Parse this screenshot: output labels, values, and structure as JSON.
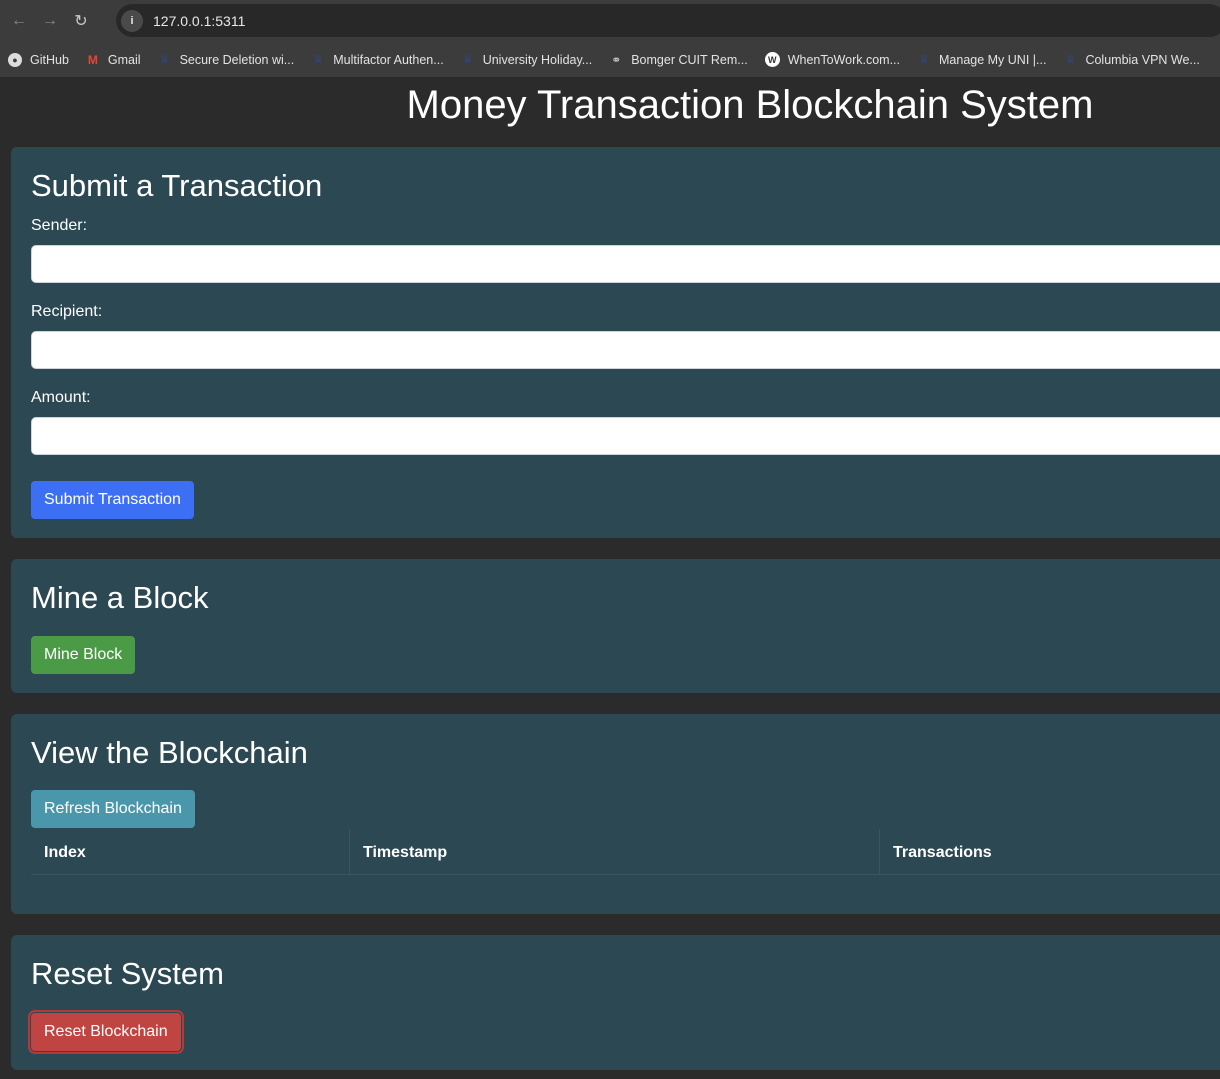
{
  "browser": {
    "url": "127.0.0.1:5311",
    "bookmarks": [
      {
        "icon": "github-icon",
        "label": "GitHub"
      },
      {
        "icon": "gmail-icon",
        "label": "Gmail"
      },
      {
        "icon": "columbia-crown-icon",
        "label": "Secure Deletion wi..."
      },
      {
        "icon": "columbia-crown-icon",
        "label": "Multifactor Authen..."
      },
      {
        "icon": "columbia-crown-icon",
        "label": "University Holiday..."
      },
      {
        "icon": "headset-icon",
        "label": "Bomger CUIT Rem..."
      },
      {
        "icon": "whentowork-icon",
        "label": "WhenToWork.com..."
      },
      {
        "icon": "columbia-crown-icon",
        "label": "Manage My UNI |..."
      },
      {
        "icon": "columbia-crown-icon",
        "label": "Columbia VPN We..."
      }
    ]
  },
  "page": {
    "title": "Money Transaction Blockchain System"
  },
  "submit": {
    "heading": "Submit a Transaction",
    "sender_label": "Sender:",
    "sender_value": "",
    "recipient_label": "Recipient:",
    "recipient_value": "",
    "amount_label": "Amount:",
    "amount_value": "",
    "button": "Submit Transaction"
  },
  "mine": {
    "heading": "Mine a Block",
    "button": "Mine Block"
  },
  "chain": {
    "heading": "View the Blockchain",
    "button": "Refresh Blockchain",
    "columns": [
      "Index",
      "Timestamp",
      "Transactions"
    ]
  },
  "reset": {
    "heading": "Reset System",
    "button": "Reset Blockchain"
  },
  "colors": {
    "card_bg": "#2c4853",
    "primary": "#3d6ff5",
    "success": "#4a9a46",
    "info": "#4a97ab",
    "danger": "#c04441"
  }
}
